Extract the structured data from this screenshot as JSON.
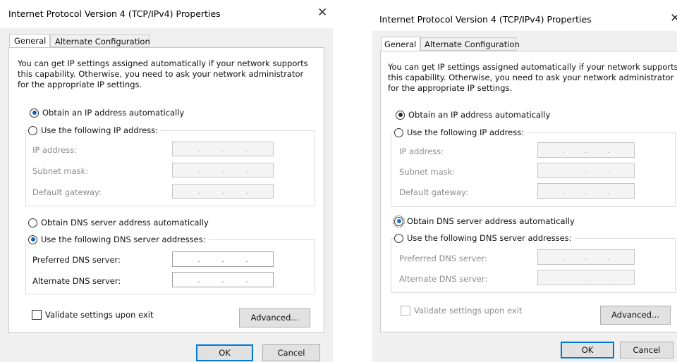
{
  "dialogs": [
    {
      "title": "Internet Protocol Version 4 (TCP/IPv4) Properties",
      "close_glyph": "✕",
      "tabs": [
        "General",
        "Alternate Configuration"
      ],
      "description": [
        "You can get IP settings assigned automatically if your network supports",
        "this capability. Otherwise, you need to ask your network administrator",
        "for the appropriate IP settings."
      ],
      "ip_auto_label": "Obtain an IP address automatically",
      "ip_manual_label": "Use the following IP address:",
      "ip_fields": [
        "IP address:",
        "Subnet mask:",
        "Default gateway:"
      ],
      "dns_auto_label": "Obtain DNS server address automatically",
      "dns_manual_label": "Use the following DNS server addresses:",
      "dns_fields": [
        "Preferred DNS server:",
        "Alternate DNS server:"
      ],
      "validate_label": "Validate settings upon exit",
      "advanced_label": "Advanced...",
      "ok_label": "OK",
      "cancel_label": "Cancel",
      "selected_ip_option": "automatic",
      "selected_dns_option": "manual",
      "dns_fields_enabled": true,
      "validate_checked": false,
      "validate_enabled": true
    },
    {
      "title": "Internet Protocol Version 4 (TCP/IPv4) Properties",
      "close_glyph": "✕",
      "tabs": [
        "General",
        "Alternate Configuration"
      ],
      "description": [
        "You can get IP settings assigned automatically if your network supports",
        "this capability. Otherwise, you need to ask your network administrator",
        "for the appropriate IP settings."
      ],
      "ip_auto_label": "Obtain an IP address automatically",
      "ip_manual_label": "Use the following IP address:",
      "ip_fields": [
        "IP address:",
        "Subnet mask:",
        "Default gateway:"
      ],
      "dns_auto_label": "Obtain DNS server address automatically",
      "dns_manual_label": "Use the following DNS server addresses:",
      "dns_fields": [
        "Preferred DNS server:",
        "Alternate DNS server:"
      ],
      "validate_label": "Validate settings upon exit",
      "advanced_label": "Advanced...",
      "ok_label": "OK",
      "cancel_label": "Cancel",
      "selected_ip_option": "automatic",
      "selected_dns_option": "automatic",
      "dns_fields_enabled": false,
      "validate_checked": false,
      "validate_enabled": false
    }
  ],
  "ip_dot": ".",
  "colors": {
    "accent": "#0078d7",
    "radio_selected": "#1a5fb4",
    "disabled_text": "#8c8c8c",
    "dialog_body": "#f0f0f0"
  }
}
